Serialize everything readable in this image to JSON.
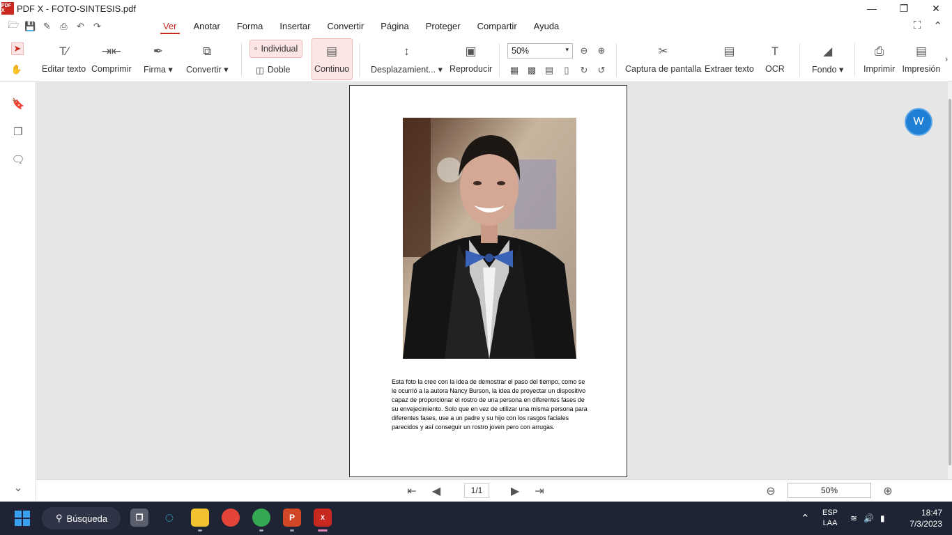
{
  "window": {
    "title": "PDF X - FOTO-SINTESIS.pdf",
    "logo_text": "PDF X"
  },
  "menu": {
    "items": [
      "Ver",
      "Anotar",
      "Forma",
      "Insertar",
      "Convertir",
      "Página",
      "Proteger",
      "Compartir",
      "Ayuda"
    ],
    "active": "Ver"
  },
  "ribbon": {
    "edit_text": "Editar texto",
    "compress": "Comprimir",
    "signature": "Firma",
    "convert": "Convertir",
    "single": "Individual",
    "double": "Doble",
    "continuous": "Continuo",
    "scroll": "Desplazamient...",
    "play": "Reproducir",
    "zoom_value": "50%",
    "screenshot": "Captura de pantalla",
    "extract_text": "Extraer texto",
    "ocr": "OCR",
    "background": "Fondo",
    "print": "Imprimir",
    "print2": "Impresión"
  },
  "document": {
    "paragraph": "Esta foto la cree con la idea de demostrar el paso del tiempo, como se le ocurrió a la autora Nancy Burson, la idea de proyectar un dispositivo capaz de proporcionar el rostro de una persona en diferentes fases de su envejecimiento. Solo que en vez de utilizar una misma persona para diferentes fases, use a un padre y su hijo con los rasgos faciales parecidos y así conseguir un rostro joven pero con arrugas."
  },
  "statusbar": {
    "page_indicator": "1/1",
    "zoom": "50%"
  },
  "taskbar": {
    "search_label": "Búsqueda",
    "lang_primary": "ESP",
    "lang_secondary": "LAA",
    "time": "18:47",
    "date": "7/3/2023"
  },
  "colors": {
    "accent": "#c8281e",
    "selected_bg": "#fbe6e5",
    "canvas_bg": "#e6e6e6",
    "taskbar_bg": "#1e2433",
    "fab_blue": "#1f7fd4"
  }
}
